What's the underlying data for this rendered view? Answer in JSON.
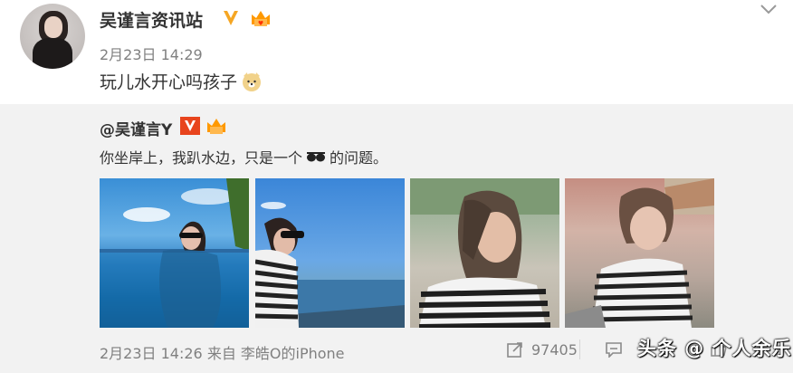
{
  "post": {
    "username": "吴谨言资讯站",
    "time": "2月23日 14:29",
    "text": "玩儿水开心吗孩子"
  },
  "repost": {
    "username": "@吴谨言Y",
    "text_before": "你坐岸上，我趴水边，只是一个",
    "text_after": "的问题。",
    "photos": [
      "photo-1",
      "photo-2",
      "photo-3",
      "photo-4"
    ],
    "meta": {
      "time_source": "2月23日 14:26 来自 李皓O的iPhone",
      "repost_count": "97405",
      "comment_count": "",
      "like_count": ""
    }
  },
  "watermark": "头条 @ 个人余乐",
  "colors": {
    "text": "#333333",
    "muted": "#808080",
    "verified": "#f5a623",
    "repost_bg": "#f2f2f2"
  },
  "icons": [
    "v-badge-icon",
    "fan-badge-icon",
    "chevron-down-icon",
    "dog-emoji-icon",
    "glasses-emoji-icon",
    "repost-icon",
    "comment-icon",
    "like-icon"
  ]
}
